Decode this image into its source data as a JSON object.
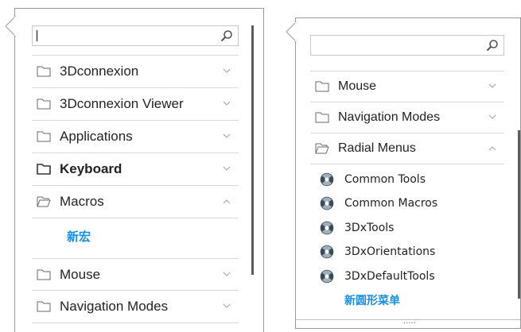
{
  "left_panel": {
    "search": {
      "value": "",
      "placeholder": ""
    },
    "items": [
      {
        "label": "3Dconnexion",
        "state": "collapsed"
      },
      {
        "label": "3Dconnexion Viewer",
        "state": "collapsed"
      },
      {
        "label": "Applications",
        "state": "collapsed"
      },
      {
        "label": "Keyboard",
        "state": "collapsed"
      },
      {
        "label": "Macros",
        "state": "expanded"
      },
      {
        "label": "Mouse",
        "state": "collapsed"
      },
      {
        "label": "Navigation Modes",
        "state": "collapsed"
      }
    ],
    "new_macro_link": "新宏"
  },
  "right_panel": {
    "search": {
      "value": "",
      "placeholder": ""
    },
    "items": [
      {
        "label": "Mouse",
        "state": "collapsed"
      },
      {
        "label": "Navigation Modes",
        "state": "collapsed"
      },
      {
        "label": "Radial Menus",
        "state": "expanded"
      }
    ],
    "radial_menus": [
      "Common Tools",
      "Common Macros",
      "3DxTools",
      "3DxOrientations",
      "3DxDefaultTools"
    ],
    "new_radial_menu_link": "新圆形菜单",
    "resize_grip": "....."
  },
  "colors": {
    "link": "#1a8fe0",
    "border": "#9a9a9a",
    "divider": "#d9d9d9",
    "scrollbar": "#5c5c5c"
  }
}
